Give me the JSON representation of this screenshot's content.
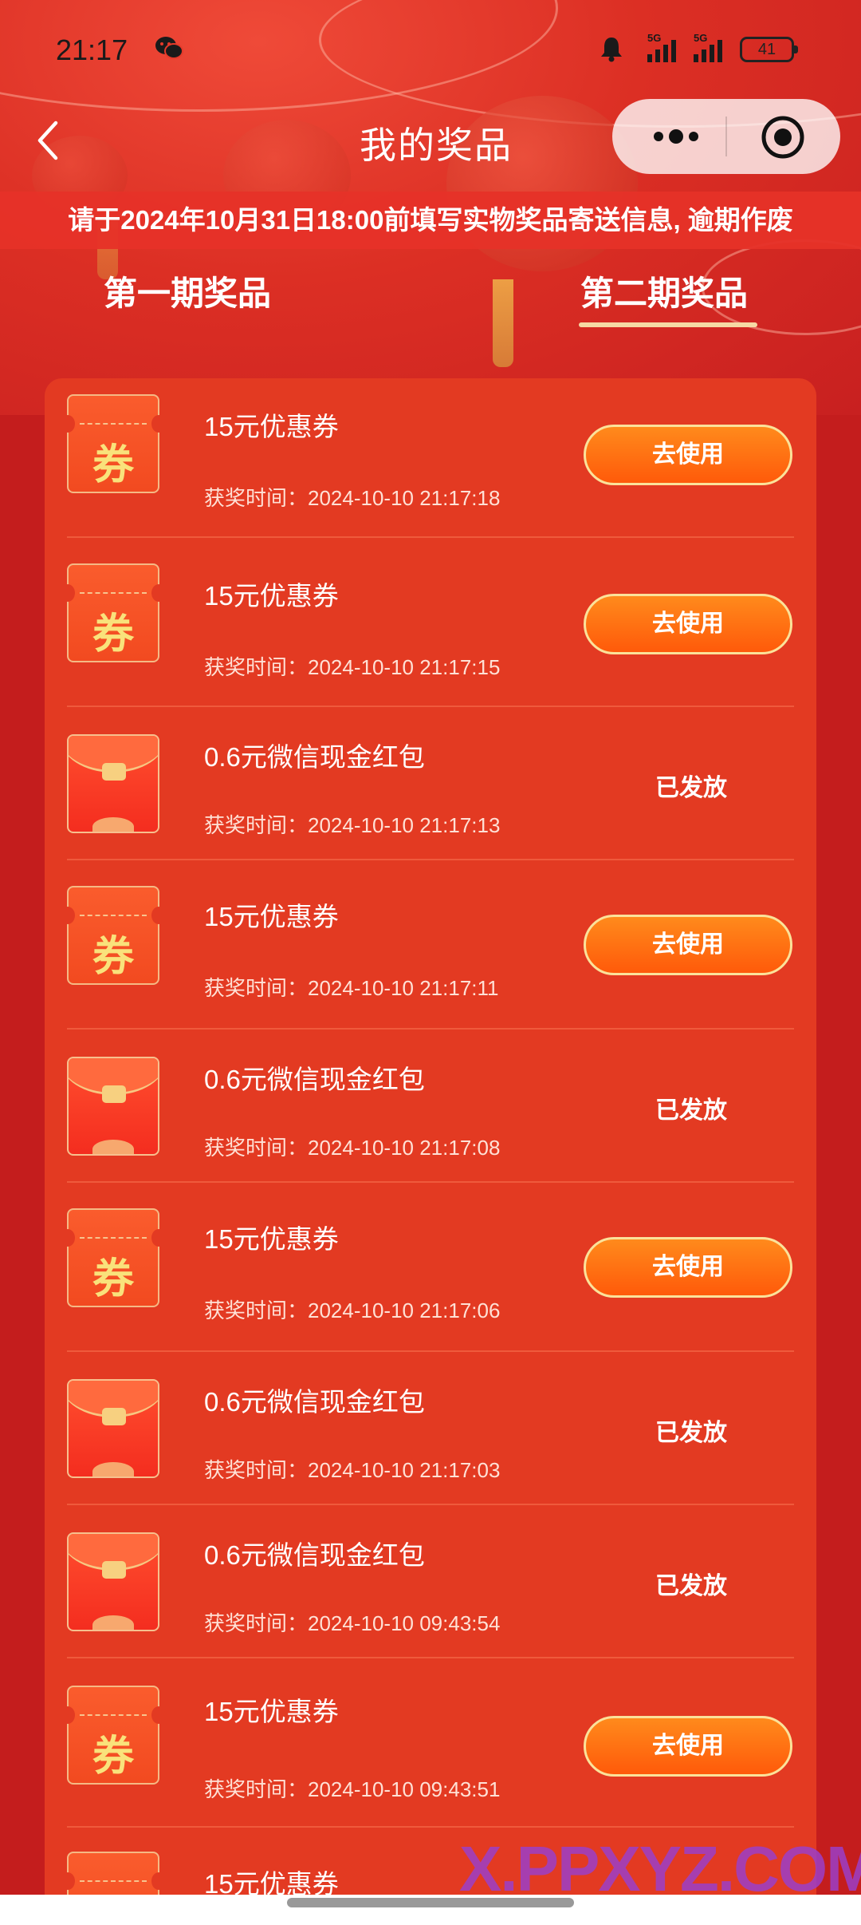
{
  "status_bar": {
    "time": "21:17",
    "network_1": "5G",
    "network_2": "5G",
    "battery": "41",
    "icons": [
      "wechat-icon",
      "bell-icon",
      "signal-icon",
      "battery-icon"
    ]
  },
  "header": {
    "title": "我的奖品",
    "icons": [
      "back-icon",
      "more-icon",
      "target-icon"
    ]
  },
  "notice": {
    "text": "请于2024年10月31日18:00前填写实物奖品寄送信息, 逾期作废"
  },
  "tabs": [
    {
      "label": "第一期奖品",
      "active": false
    },
    {
      "label": "第二期奖品",
      "active": true
    }
  ],
  "prizes": [
    {
      "type": "coupon",
      "name": "15元优惠券",
      "time": "获奖时间：2024-10-10 21:17:18",
      "action": "去使用"
    },
    {
      "type": "coupon",
      "name": "15元优惠券",
      "time": "获奖时间：2024-10-10 21:17:15",
      "action": "去使用"
    },
    {
      "type": "redpacket",
      "name": "0.6元微信现金红包",
      "time": "获奖时间：2024-10-10 21:17:13",
      "status": "已发放"
    },
    {
      "type": "coupon",
      "name": "15元优惠券",
      "time": "获奖时间：2024-10-10 21:17:11",
      "action": "去使用"
    },
    {
      "type": "redpacket",
      "name": "0.6元微信现金红包",
      "time": "获奖时间：2024-10-10 21:17:08",
      "status": "已发放"
    },
    {
      "type": "coupon",
      "name": "15元优惠券",
      "time": "获奖时间：2024-10-10 21:17:06",
      "action": "去使用"
    },
    {
      "type": "redpacket",
      "name": "0.6元微信现金红包",
      "time": "获奖时间：2024-10-10 21:17:03",
      "status": "已发放"
    },
    {
      "type": "redpacket",
      "name": "0.6元微信现金红包",
      "time": "获奖时间：2024-10-10 09:43:54",
      "status": "已发放"
    },
    {
      "type": "coupon",
      "name": "15元优惠券",
      "time": "获奖时间：2024-10-10 09:43:51",
      "action": "去使用"
    },
    {
      "type": "coupon",
      "name": "15元优惠券",
      "time": "",
      "action": ""
    }
  ],
  "coupon_glyph": "券",
  "watermark": {
    "logo": "X.PPXYZ.COM",
    "url": "x.ppxyz.com"
  },
  "colors": {
    "background": "#c41d1d",
    "panel": "#e33a22",
    "button": "#ff6f12",
    "tab_underline": "#f6d9a4"
  }
}
